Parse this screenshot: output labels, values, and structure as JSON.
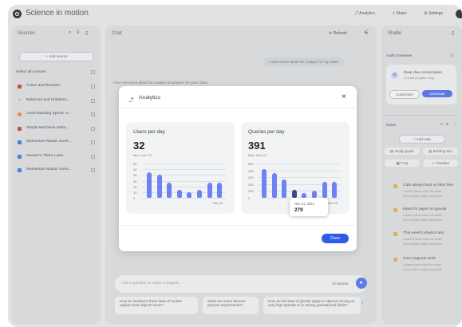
{
  "app": {
    "title": "Science in motion"
  },
  "topbar": {
    "analytics": "Analytics",
    "share": "Share",
    "settings": "Settings"
  },
  "sources": {
    "header": "Sources",
    "add_label": "+ Add source",
    "select_all": "Select all sources",
    "items": [
      {
        "label": "Action and Reaction",
        "icon": "document-icon",
        "color": "#c0392b"
      },
      {
        "label": "Balanced and Unbalanc...",
        "icon": "star-icon",
        "color": "#d4a017"
      },
      {
        "label": "Understanding Speed, V...",
        "icon": "circle-icon",
        "color": "#e67e22"
      },
      {
        "label": "Simple Machines Make...",
        "icon": "document-icon",
        "color": "#c0392b"
      },
      {
        "label": "Momentum Mania: Inves...",
        "icon": "document-icon",
        "color": "#2f6fd6"
      },
      {
        "label": "Newton's Three Laws...",
        "icon": "document-icon",
        "color": "#2f6fd6"
      },
      {
        "label": "Momentum Mania: Inves...",
        "icon": "slides-icon",
        "color": "#2f6fd6"
      }
    ]
  },
  "chat": {
    "header": "Chat",
    "refresh": "Refresh",
    "user_message": "I need some ideas for a paper for my class",
    "assistant_intro": "Here are some ideas for a paper on physics for your class:",
    "input_placeholder": "Ask a question or make a request...",
    "source_count": "10 sources",
    "suggestions": [
      "How do Newton's three laws of motion explain how objects move?",
      "What are some famous physics experiments?",
      "How do the laws of gravity apply to objects moving at very high speeds or in strong gravitational fields?"
    ]
  },
  "studio": {
    "header": "Studio",
    "audio_overview": "Audio Overview",
    "deep_dive": "Deep dive conversation",
    "deep_dive_sub": "2 hosts (English only)",
    "customize": "Customize",
    "generate": "Generate",
    "notes": "Notes",
    "add_note": "+ Add note",
    "study_guide": "Study guide",
    "briefing_doc": "Briefing doc",
    "faq": "FAQ",
    "timeline": "Timeline",
    "note_items": [
      {
        "title": "Cats always land on their feet",
        "l1": "Lorem ipsum dolor sit amet,",
        "l2": "cons ectetur adipi scing elit..."
      },
      {
        "title": "Ideas for paper on gravity",
        "l1": "Lorem ipsum dolor sit amet,",
        "l2": "cons ectetur adipi scing elit..."
      },
      {
        "title": "This week's physics test",
        "l1": "Lorem ipsum dolor sit amet,",
        "l2": "cons ectetur adipi scing elit..."
      },
      {
        "title": "How magnets work",
        "l1": "Lorem ipsum dolor sit amet,",
        "l2": "cons ectetur adipi scing elit..."
      }
    ]
  },
  "modal": {
    "title": "Analytics",
    "done": "Done",
    "accent": "#2f5be8",
    "users_card": {
      "title": "Users per day",
      "value": "32",
      "date": "Mon, Nov 25",
      "x_tick": "Nov 25"
    },
    "queries_card": {
      "title": "Queries per day",
      "value": "391",
      "date": "Mon, Nov 25",
      "x_tick": "Nov 25"
    },
    "tooltip": {
      "date": "Nov 21, 2024",
      "value": "279"
    }
  },
  "chart_data": [
    {
      "type": "bar",
      "title": "Users per day",
      "ylim": [
        0,
        60
      ],
      "y_ticks": [
        "60",
        "50",
        "40",
        "30",
        "20",
        "10",
        "0"
      ],
      "values": [
        44,
        40,
        26,
        14,
        10,
        14,
        26,
        26
      ],
      "x_ticks": [
        "Nov 25"
      ]
    },
    {
      "type": "bar",
      "title": "Queries per day",
      "ylim": [
        0,
        500
      ],
      "y_ticks": [
        "500",
        "400",
        "300",
        "200",
        "100",
        "0"
      ],
      "values": [
        420,
        360,
        270,
        120,
        70,
        110,
        230,
        230
      ],
      "highlight_index": 3,
      "x_ticks": [
        "Nov 25"
      ]
    }
  ]
}
